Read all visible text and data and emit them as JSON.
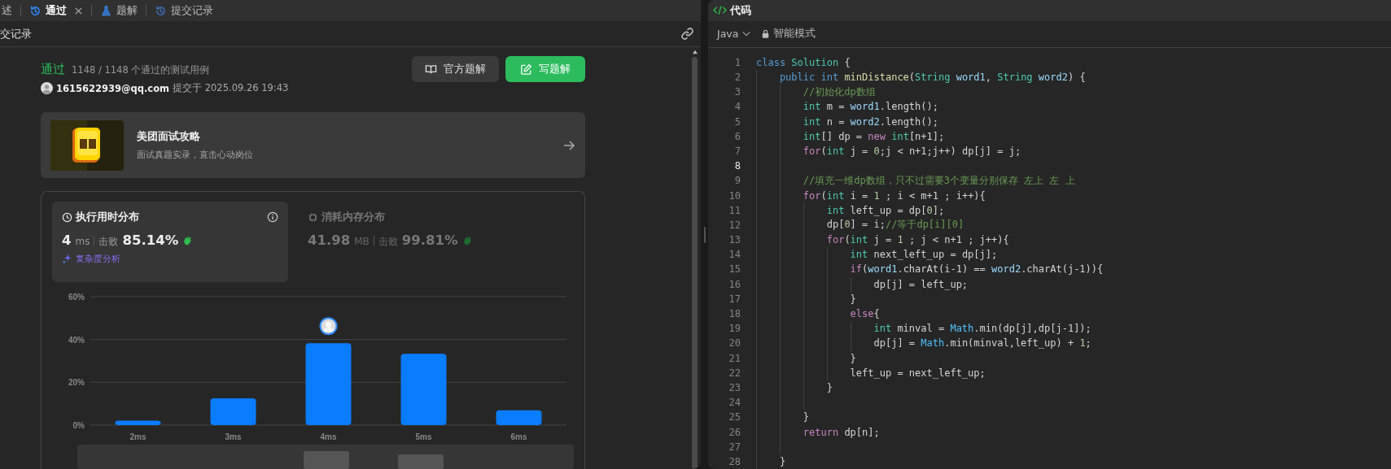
{
  "tabs": [
    {
      "label": "述",
      "kind": "description",
      "selected": false,
      "closable": false
    },
    {
      "label": "通过",
      "kind": "result",
      "selected": true,
      "closable": true
    },
    {
      "label": "题解",
      "kind": "solutions",
      "selected": false,
      "closable": false
    },
    {
      "label": "提交记录",
      "kind": "submissions",
      "selected": false,
      "closable": false
    }
  ],
  "panel_title": "交记录",
  "submission": {
    "status": "通过",
    "cases": "1148 / 1148 个通过的测试用例",
    "user": "1615622939@qq.com",
    "submitted": "提交于 2025.09.26 19:43",
    "buttons": [
      {
        "label": "官方题解",
        "kind": "book",
        "primary": false
      },
      {
        "label": "写题解",
        "kind": "edit",
        "primary": true
      }
    ]
  },
  "promo": {
    "kind": "picture",
    "title": "美团面试攻略",
    "subtitle": "面试真题实录，直击心动岗位"
  },
  "stats": [
    {
      "title": "执行用时分布",
      "kind": "time",
      "selected": true,
      "value": "4",
      "unit": "ms",
      "beat_label": "击败",
      "beat": "85.14%",
      "analysis": "复杂度分析"
    },
    {
      "title": "消耗内存分布",
      "kind": "memory",
      "selected": false,
      "value": "41.98",
      "unit": "MB",
      "beat_label": "击败",
      "beat": "99.81%"
    }
  ],
  "chart_data": {
    "type": "bar",
    "categories": [
      "2ms",
      "3ms",
      "4ms",
      "5ms",
      "6ms"
    ],
    "series": [
      {
        "color": "#0a7cff",
        "values": [
          2.1,
          12.5,
          38.3,
          33.3,
          6.9
        ]
      }
    ],
    "ylim": [
      0,
      60
    ],
    "yticks": [
      {
        "value": 0,
        "label": "0%"
      },
      {
        "value": 20,
        "label": "20%"
      },
      {
        "value": 40,
        "label": "40%"
      },
      {
        "value": 60,
        "label": "60%"
      }
    ],
    "annotations": [
      {
        "x": "4ms"
      }
    ]
  },
  "code": {
    "title": "代码",
    "language": "Java",
    "mode": "智能模式",
    "lines": [
      {
        "number": "1",
        "current": false,
        "tokens": [
          {
            "kind": "storage",
            "text": "class "
          },
          {
            "kind": "type",
            "text": "Solution"
          },
          {
            "kind": "plain",
            "text": " {"
          }
        ]
      },
      {
        "number": "2",
        "current": false,
        "tokens": [
          {
            "kind": "storage",
            "text": "    public int "
          },
          {
            "kind": "func",
            "text": "minDistance"
          },
          {
            "kind": "plain",
            "text": "("
          },
          {
            "kind": "type",
            "text": "String "
          },
          {
            "kind": "var",
            "text": "word1"
          },
          {
            "kind": "plain",
            "text": ", "
          },
          {
            "kind": "type",
            "text": "String "
          },
          {
            "kind": "var",
            "text": "word2"
          },
          {
            "kind": "plain",
            "text": ") {"
          }
        ]
      },
      {
        "number": "3",
        "current": false,
        "tokens": [
          {
            "kind": "comment",
            "text": "        //初始化dp数组"
          }
        ]
      },
      {
        "number": "4",
        "current": false,
        "tokens": [
          {
            "kind": "type",
            "text": "        int"
          },
          {
            "kind": "plain",
            "text": " m = "
          },
          {
            "kind": "var",
            "text": "word1"
          },
          {
            "kind": "plain",
            "text": ".length();"
          }
        ]
      },
      {
        "number": "5",
        "current": false,
        "tokens": [
          {
            "kind": "type",
            "text": "        int"
          },
          {
            "kind": "plain",
            "text": " n = "
          },
          {
            "kind": "var",
            "text": "word2"
          },
          {
            "kind": "plain",
            "text": ".length();"
          }
        ]
      },
      {
        "number": "6",
        "current": false,
        "tokens": [
          {
            "kind": "type",
            "text": "        int"
          },
          {
            "kind": "plain",
            "text": "[] dp = "
          },
          {
            "kind": "control",
            "text": "new "
          },
          {
            "kind": "type",
            "text": "int"
          },
          {
            "kind": "plain",
            "text": "[n+1];"
          }
        ]
      },
      {
        "number": "7",
        "current": false,
        "tokens": [
          {
            "kind": "control",
            "text": "        for"
          },
          {
            "kind": "plain",
            "text": "("
          },
          {
            "kind": "type",
            "text": "int"
          },
          {
            "kind": "plain",
            "text": " j = "
          },
          {
            "kind": "number",
            "text": "0"
          },
          {
            "kind": "plain",
            "text": ";j < n+1;j++) dp[j] = j;"
          }
        ]
      },
      {
        "number": "8",
        "current": true
      },
      {
        "number": "9",
        "current": false,
        "tokens": [
          {
            "kind": "comment",
            "text": "        //填充一维dp数组，只不过需要3个变量分别保存 左上 左 上"
          }
        ]
      },
      {
        "number": "10",
        "current": false,
        "tokens": [
          {
            "kind": "control",
            "text": "        for"
          },
          {
            "kind": "plain",
            "text": "("
          },
          {
            "kind": "type",
            "text": "int"
          },
          {
            "kind": "plain",
            "text": " i = "
          },
          {
            "kind": "number",
            "text": "1"
          },
          {
            "kind": "plain",
            "text": " ; i < m+1 ; i++){"
          }
        ]
      },
      {
        "number": "11",
        "current": false,
        "tokens": [
          {
            "kind": "type",
            "text": "            int"
          },
          {
            "kind": "plain",
            "text": " left_up = dp["
          },
          {
            "kind": "number",
            "text": "0"
          },
          {
            "kind": "plain",
            "text": "];"
          }
        ]
      },
      {
        "number": "12",
        "current": false,
        "tokens": [
          {
            "kind": "plain",
            "text": "            dp["
          },
          {
            "kind": "number",
            "text": "0"
          },
          {
            "kind": "plain",
            "text": "] = i;"
          },
          {
            "kind": "comment",
            "text": "//等于dp[i][0]"
          }
        ]
      },
      {
        "number": "13",
        "current": false,
        "tokens": [
          {
            "kind": "control",
            "text": "            for"
          },
          {
            "kind": "plain",
            "text": "("
          },
          {
            "kind": "type",
            "text": "int"
          },
          {
            "kind": "plain",
            "text": " j = "
          },
          {
            "kind": "number",
            "text": "1"
          },
          {
            "kind": "plain",
            "text": " ; j < n+1 ; j++){"
          }
        ]
      },
      {
        "number": "14",
        "current": false,
        "tokens": [
          {
            "kind": "type",
            "text": "                int"
          },
          {
            "kind": "plain",
            "text": " next_left_up = dp[j];"
          }
        ]
      },
      {
        "number": "15",
        "current": false,
        "tokens": [
          {
            "kind": "control",
            "text": "                if"
          },
          {
            "kind": "plain",
            "text": "("
          },
          {
            "kind": "var",
            "text": "word1"
          },
          {
            "kind": "plain",
            "text": ".charAt(i-1) == "
          },
          {
            "kind": "var",
            "text": "word2"
          },
          {
            "kind": "plain",
            "text": ".charAt(j-1)){"
          }
        ]
      },
      {
        "number": "16",
        "current": false,
        "tokens": [
          {
            "kind": "plain",
            "text": "                    dp[j] = left_up;"
          }
        ]
      },
      {
        "number": "17",
        "current": false,
        "tokens": [
          {
            "kind": "plain",
            "text": "                }"
          }
        ]
      },
      {
        "number": "18",
        "current": false,
        "tokens": [
          {
            "kind": "control",
            "text": "                else"
          },
          {
            "kind": "plain",
            "text": "{"
          }
        ]
      },
      {
        "number": "19",
        "current": false,
        "tokens": [
          {
            "kind": "type",
            "text": "                    int"
          },
          {
            "kind": "plain",
            "text": " minval = "
          },
          {
            "kind": "class",
            "text": "Math"
          },
          {
            "kind": "plain",
            "text": ".min(dp[j],dp[j-1]);"
          }
        ]
      },
      {
        "number": "20",
        "current": false,
        "tokens": [
          {
            "kind": "plain",
            "text": "                    dp[j] = "
          },
          {
            "kind": "class",
            "text": "Math"
          },
          {
            "kind": "plain",
            "text": ".min(minval,left_up) + "
          },
          {
            "kind": "number",
            "text": "1"
          },
          {
            "kind": "plain",
            "text": ";"
          }
        ]
      },
      {
        "number": "21",
        "current": false,
        "tokens": [
          {
            "kind": "plain",
            "text": "                }"
          }
        ]
      },
      {
        "number": "22",
        "current": false,
        "tokens": [
          {
            "kind": "plain",
            "text": "                left_up = next_left_up;"
          }
        ]
      },
      {
        "number": "23",
        "current": false,
        "tokens": [
          {
            "kind": "plain",
            "text": "            }"
          }
        ]
      },
      {
        "number": "24",
        "current": false
      },
      {
        "number": "25",
        "current": false,
        "tokens": [
          {
            "kind": "plain",
            "text": "        }"
          }
        ]
      },
      {
        "number": "26",
        "current": false,
        "tokens": [
          {
            "kind": "control",
            "text": "        return"
          },
          {
            "kind": "plain",
            "text": " dp[n];"
          }
        ]
      },
      {
        "number": "27",
        "current": false
      },
      {
        "number": "28",
        "current": false,
        "tokens": [
          {
            "kind": "plain",
            "text": "    }"
          }
        ]
      }
    ]
  }
}
